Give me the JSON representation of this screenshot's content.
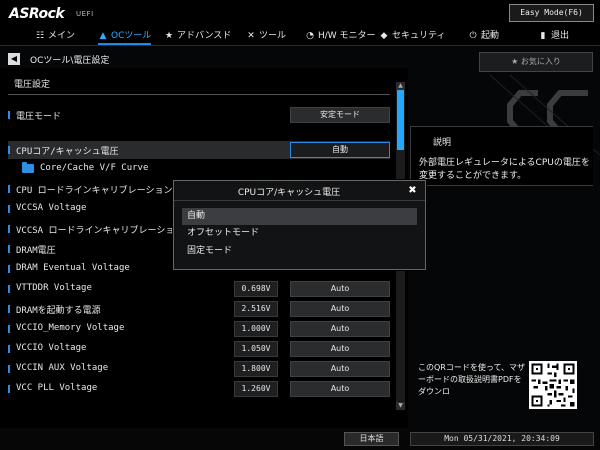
{
  "header": {
    "logo": "ASRock",
    "logo_sub": "UEFI",
    "easy_mode_label": "Easy Mode(F6)"
  },
  "nav": {
    "items": [
      {
        "label": "メイン",
        "icon": "grid-icon"
      },
      {
        "label": "OCツール",
        "icon": "rocket-icon",
        "active": true
      },
      {
        "label": "アドバンスド",
        "icon": "star-icon"
      },
      {
        "label": "ツール",
        "icon": "tools-icon"
      },
      {
        "label": "H/W モニター",
        "icon": "monitor-icon"
      },
      {
        "label": "セキュリティ",
        "icon": "shield-icon"
      },
      {
        "label": "起動",
        "icon": "power-icon"
      },
      {
        "label": "退出",
        "icon": "exit-icon"
      }
    ]
  },
  "breadcrumb": "OCツール\\電圧設定",
  "favorites_label": "お気に入り",
  "section_title": "電圧設定",
  "rows": [
    {
      "label": "電圧モード",
      "option": "安定モード"
    },
    {
      "label": "CPUコア/キャッシュ電圧",
      "option": "自動"
    },
    {
      "label": "Core/Cache V/F Curve"
    },
    {
      "label": "CPU ロードラインキャリブレーション"
    },
    {
      "label": "VCCSA Voltage"
    },
    {
      "label": "VCCSA ロードラインキャリブレーション"
    },
    {
      "label": "DRAM電圧"
    },
    {
      "label": "DRAM Eventual Voltage"
    },
    {
      "label": "VTTDDR Voltage",
      "value": "0.698V",
      "option": "Auto"
    },
    {
      "label": "DRAMを起動する電源",
      "value": "2.516V",
      "option": "Auto"
    },
    {
      "label": "VCCIO_Memory Voltage",
      "value": "1.000V",
      "option": "Auto"
    },
    {
      "label": "VCCIO Voltage",
      "value": "1.050V",
      "option": "Auto"
    },
    {
      "label": "VCCIN AUX Voltage",
      "value": "1.800V",
      "option": "Auto"
    },
    {
      "label": "VCC PLL Voltage",
      "value": "1.260V",
      "option": "Auto"
    }
  ],
  "description": {
    "title": "説明",
    "body": "外部電圧レギュレータによるCPUの電圧を変更することができます。"
  },
  "qr_text": "このQRコードを使って、マザーボードの取扱説明書PDFをダウンロ",
  "popup": {
    "title": "CPUコア/キャッシュ電圧",
    "options": [
      "自動",
      "オフセットモード",
      "固定モード"
    ],
    "selected": 0
  },
  "footer": {
    "language": "日本語",
    "datetime": "Mon 05/31/2021, 20:34:09"
  },
  "colors": {
    "accent": "#1d8ae8",
    "scroll_thumb": "#27a6ff"
  }
}
